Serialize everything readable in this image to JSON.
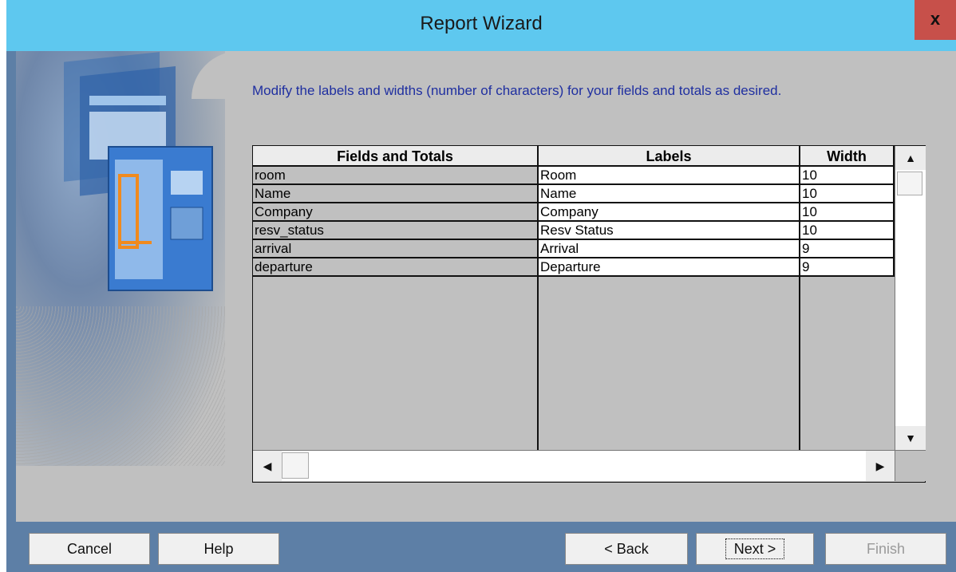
{
  "window": {
    "title": "Report Wizard",
    "close_label": "x"
  },
  "instruction": "Modify the labels and widths (number of characters) for your fields and totals as desired.",
  "grid": {
    "columns": [
      "Fields and Totals",
      "Labels",
      "Width"
    ],
    "rows": [
      {
        "field": "room",
        "label": "Room",
        "width": "10"
      },
      {
        "field": "Name",
        "label": "Name",
        "width": "10"
      },
      {
        "field": "Company",
        "label": "Company",
        "width": "10"
      },
      {
        "field": "resv_status",
        "label": "Resv Status",
        "width": "10"
      },
      {
        "field": "arrival",
        "label": "Arrival",
        "width": "9"
      },
      {
        "field": "departure",
        "label": "Departure",
        "width": "9"
      }
    ]
  },
  "buttons": {
    "cancel": "Cancel",
    "help": "Help",
    "back": "< Back",
    "next": "Next >",
    "finish": "Finish"
  },
  "icons": {
    "close": "close-icon",
    "scroll_up": "scroll-up-arrow-icon",
    "scroll_down": "scroll-down-arrow-icon",
    "scroll_left": "scroll-left-arrow-icon",
    "scroll_right": "scroll-right-arrow-icon"
  },
  "colors": {
    "titlebar": "#5ec8ef",
    "close_button": "#c7504a",
    "frame": "#5d7fa6",
    "content": "#c0c0c0",
    "instruction_text": "#1f2fa0"
  }
}
